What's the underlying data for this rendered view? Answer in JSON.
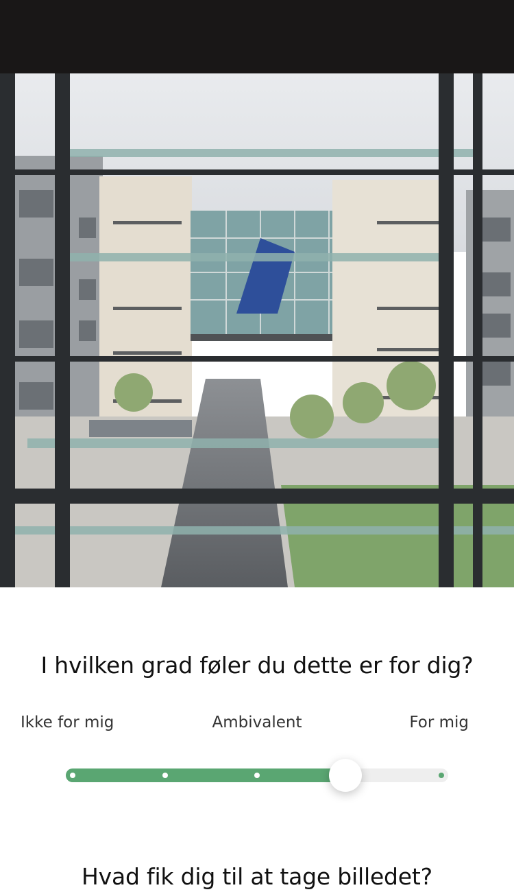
{
  "question_1": "I hvilken grad føler du dette er for dig?",
  "scale": {
    "left_label": "Ikke for mig",
    "middle_label": "Ambivalent",
    "right_label": "For mig",
    "steps": 5,
    "value_fraction": 0.74,
    "fill_color": "#5aa672"
  },
  "question_2": "Hvad fik dig til at tage billedet?",
  "photo": {
    "subject": "view-through-glass-facade-of-campus-buildings"
  }
}
